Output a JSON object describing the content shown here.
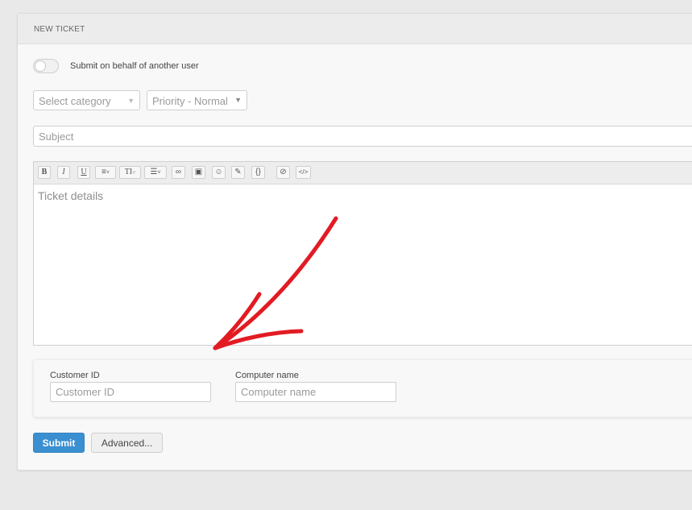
{
  "panel": {
    "title": "NEW TICKET"
  },
  "toggle": {
    "label": "Submit on behalf of another user",
    "on": false
  },
  "category": {
    "selected": "Select category"
  },
  "priority": {
    "selected": "Priority - Normal"
  },
  "subject": {
    "placeholder": "Subject"
  },
  "editor": {
    "placeholder": "Ticket details",
    "toolbar": [
      {
        "name": "bold",
        "label": "B"
      },
      {
        "name": "italic",
        "label": "I"
      },
      {
        "name": "underline",
        "label": "U"
      },
      {
        "name": "align",
        "label": "≡"
      },
      {
        "name": "text-size",
        "label": "TI"
      },
      {
        "name": "list",
        "label": "☰"
      },
      {
        "name": "link",
        "label": "∞"
      },
      {
        "name": "image",
        "label": "▣"
      },
      {
        "name": "emoji",
        "label": "☺"
      },
      {
        "name": "color",
        "label": "✎"
      },
      {
        "name": "code",
        "label": "{}"
      },
      {
        "name": "clear",
        "label": "⊘"
      },
      {
        "name": "html",
        "label": "</>"
      }
    ]
  },
  "custom_fields": {
    "customer_id": {
      "label": "Customer ID",
      "placeholder": "Customer ID"
    },
    "computer_name": {
      "label": "Computer name",
      "placeholder": "Computer name"
    }
  },
  "actions": {
    "submit": "Submit",
    "advanced": "Advanced..."
  },
  "colors": {
    "primary": "#3a8fd0",
    "annotation": "#e21b23",
    "background": "#e9e9ea"
  }
}
